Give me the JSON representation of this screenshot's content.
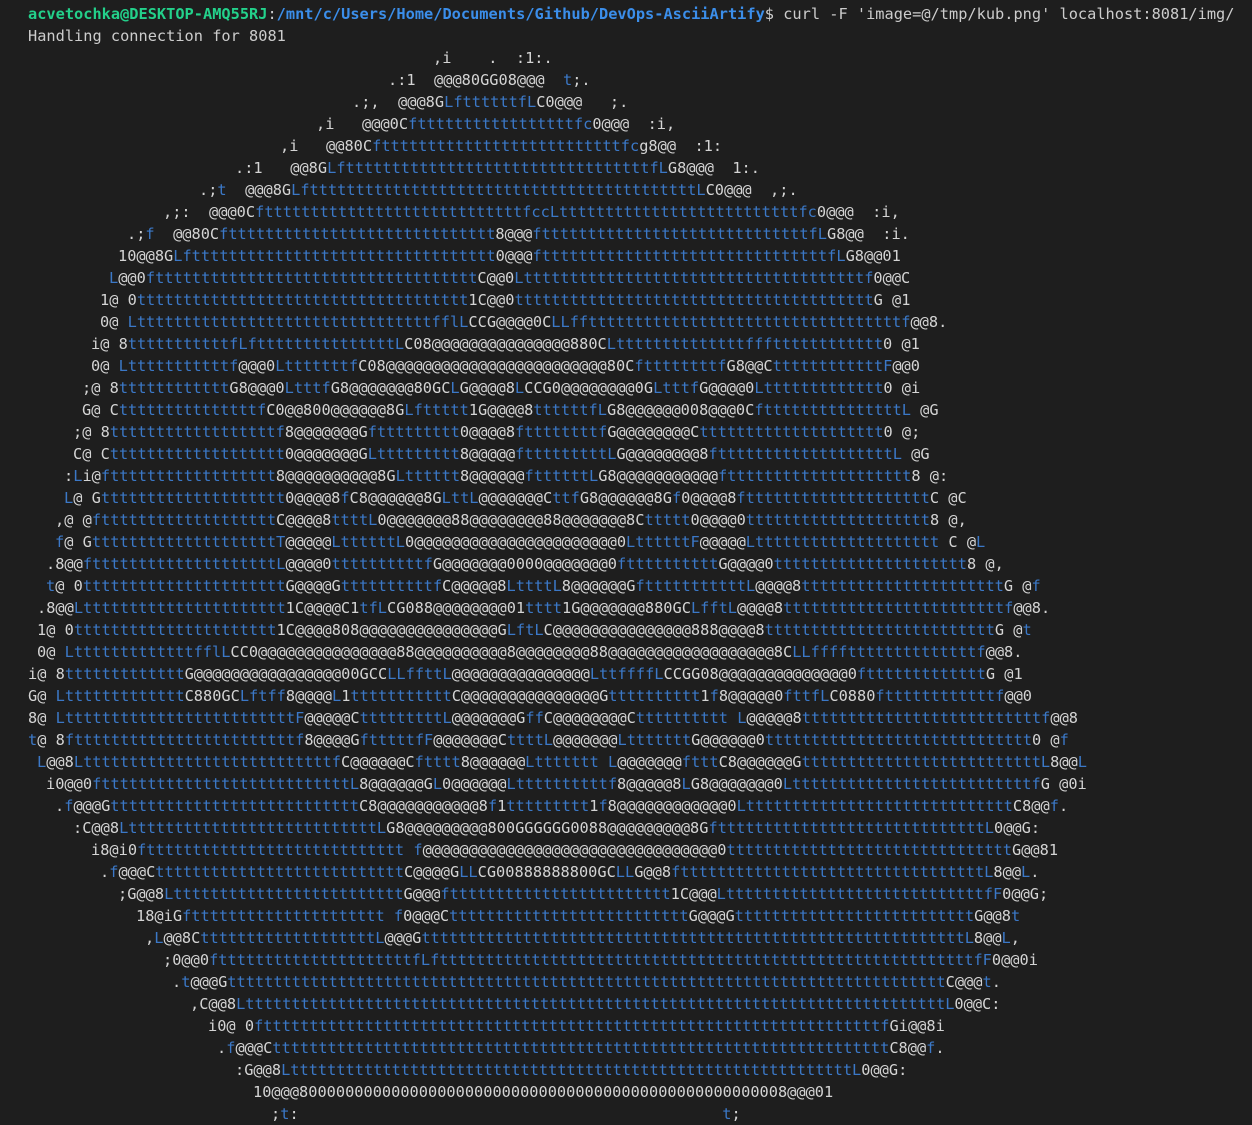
{
  "terminal": {
    "user_host": "acvetochka@DESKTOP-AMQ55RJ",
    "path_sep": ":",
    "cwd": "/mnt/c/Users/Home/Documents/Github/DevOps-AsciiArtify",
    "prompt_symbol": "$",
    "command": " curl -F 'image=@/tmp/kub.png' localhost:8081/img/",
    "status": "Handling connection for 8081",
    "colors": {
      "background": "#1e1e1e",
      "text": "#cccccc",
      "user": "#23d18b",
      "path": "#3b8eea",
      "art_fill": "#3b78c7",
      "art_edge": "#d4d4d4",
      "art_accent": "#d670d6"
    }
  },
  "art": {
    "lines": [
      {
        "indent": 433,
        "text": ",i    .  :1:."
      },
      {
        "indent": 388,
        "text": ".:1  @@@80GG08@@@  t;."
      },
      {
        "indent": 352,
        "text": ".;,  @@@8GLfttttttfLC0@@@   ;."
      },
      {
        "indent": 316,
        "text": ",i   @@@0Cftttttttttttttttttfc0@@@  :i,"
      },
      {
        "indent": 280,
        "text": ",i   @@80Cfttttttttttttttttttttttttttfcg8@@  :1:"
      },
      {
        "indent": 235,
        "text": ".:1   @@8GLftttttttttttttttttttttttttttttttttfLG8@@@  1:."
      },
      {
        "indent": 199,
        "text": ".;t  @@@8GLfttttttttttttttttttttttttttttttttttttttttttLC0@@@  ,;."
      },
      {
        "indent": 163,
        "text": ",;:  @@@0CfttttttttttttttttttttttttttttfccLttttttttttttttttttttttttttfc0@@@  :i,"
      },
      {
        "indent": 127,
        "text": ".;f  @@80Cfttttttttttttttttttttttttttttt8@@@ftttttttttttttttttttttttttttttfLG8@@  :i."
      },
      {
        "indent": 118,
        "text": "10@@8GLfttttttttttttttttttttttttttttttttt0@@@ftttttttttttttttttttttttttttttttfLG8@@01"
      },
      {
        "indent": 109,
        "text": "L@@0ftttttttttttttttttttttttttttttttttttC@@0Ltttttttttttttttttttttttttttttttttttttf0@@C"
      },
      {
        "indent": 100,
        "text": "1@ 0tttttttttttttttttttttttttttttttttttt1C@@0tttttttttttttttttttttttttttttttttttttttG @1"
      },
      {
        "indent": 100,
        "text": "0@ LttttttttttttttttttttttttttttttttfflLCCG@@@@0CLLffttttttttttttttttttttttttttttttttttf@@8."
      },
      {
        "indent": 91,
        "text": "i@ 8tttttttttttfLftttttttttttttttLC08@@@@@@@@@@@@@@@880CLttttttttttttttffftttttttttttt0 @1"
      },
      {
        "indent": 91,
        "text": "0@ Ltttttttttttf@@@0LtttttttfC08@@@@@@@@@@@@@@@@@@@@@@@@80CfttttttttfG8@@CttttttttttttF@@0"
      },
      {
        "indent": 82,
        "text": ";@ 8ttttttttttttG8@@@0LtttfG8@@@@@@@80GCLG@@@@8LCCG0@@@@@@@@0GLtttfG@@@@0Lttttttttttttt0 @i"
      },
      {
        "indent": 82,
        "text": "G@ CtttttttttttttttfC0@@800@@@@@@8GLfttttt1G@@@@8ttttttfLG8@@@@@@008@@@0CftttttttttttttttL @G"
      },
      {
        "indent": 73,
        "text": ";@ 8ttttttttttttttttttf8@@@@@@@Gfttttttttt0@@@@8fttttttttfG@@@@@@@@Ctttttttttttttttttttt0 @;"
      },
      {
        "indent": 73,
        "text": "C@ Cttttttttttttttttttt0@@@@@@@GLttttttttt8@@@@@ftttttttttLG@@@@@@@@8ftttttttttttttttttttL @G"
      },
      {
        "indent": 64,
        "text": ":Li@ftttttttttttttttttt8@@@@@@@@@@8GLtttttt8@@@@@@fttttttLG8@@@@@@@@@@@ftttttttttttttttttttt8 @:"
      },
      {
        "indent": 64,
        "text": "L@ Gtttttttttttttttttttt0@@@@8fC8@@@@@@8GLttL@@@@@@@CttfG8@@@@@@8Gf0@@@@8fttttttttttttttttttttC @C"
      },
      {
        "indent": 55,
        "text": ",@ @ftttttttttttttttttttC@@@@8ttttL0@@@@@@@88@@@@@@@@88@@@@@@@8Cttttt0@@@@0tttttttttttttttttttt8 @,"
      },
      {
        "indent": 55,
        "text": "f@ GttttttttttttttttttttT@@@@@LttttttL0@@@@@@@@@@@@@@@@@@@@@@0LttttttF@@@@@Ltttttttttttttttttttt C @L"
      },
      {
        "indent": 46,
        "text": ".8@@fttttttttttttttttttttL@@@@0ttttttttttfG@@@@@@@0000@@@@@@@0fttttttttttG@@@@0ttttttttttttttttttttt8 @,"
      },
      {
        "indent": 46,
        "text": "t@ 0ttttttttttttttttttttttG@@@@GttttttttttfC@@@@@8LttttL8@@@@@@GftttttttttttL@@@@8ttttttttttttttttttttttG @f"
      },
      {
        "indent": 37,
        "text": ".8@@Ltttttttttttttttttttttt1C@@@@C1tfLCG088@@@@@@@@01tttt1G@@@@@@@880GCLfftL@@@@8ttttttttttttttttttttttttf@@8."
      },
      {
        "indent": 37,
        "text": "1@ 0tttttttttttttttttttttt1C@@@@808@@@@@@@@@@@@@@@GLftLC@@@@@@@@@@@@@@@888@@@@8tttttttttttttttttttttttttG @t"
      },
      {
        "indent": 37,
        "text": "0@ LtttttttttttttfflLCC0@@@@@@@@@@@@@@@88@@@@@@@@@@8@@@@@@@@88@@@@@@@@@@@@@@@@@@8CLLffffttttttttttttttf@@8."
      },
      {
        "indent": 28,
        "text": "i@ 8tttttttttttttG@@@@@@@@@@@@@@@@00GCCLLffttL@@@@@@@@@@@@@@@LttffffLCCGG08@@@@@@@@@@@@@@0ftttttttttttttG @1"
      },
      {
        "indent": 28,
        "text": "G@ LtttttttttttttC880GCLftff8@@@@L1tttttttttttC@@@@@@@@@@@@@@@Gtttttttttt1f8@@@@@0fttfLC0880fttttttttttttf@@0"
      },
      {
        "indent": 28,
        "text": "8@ LtttttttttttttttttttttttttF@@@@@CtttttttttL@@@@@@@GffC@@@@@@@@Ctttttttttt L@@@@@8ttttttttttttttttttttttttttf@@8"
      },
      {
        "indent": 28,
        "text": "t@ 8fttttttttttttttttttttttttf8@@@@GftttttfF@@@@@@@CttttL@@@@@@@LtttttttG@@@@@@0ttttttttttttttttttttttttttttt0 @f"
      },
      {
        "indent": 37,
        "text": "L@@8LtttttttttttttttttttttttttttfC@@@@@@Cftttt8@@@@@@Lttttttt L@@@@@@@ftttC8@@@@@@GttttttttttttttttttttttttttL8@@L"
      },
      {
        "indent": 46,
        "text": "i0@@0ftttttttttttttttttttttttttttL8@@@@@@GL0@@@@@@Lttttttttttf8@@@@@8LG8@@@@@@@0LttttttttttttttttttttttttttfG @0i"
      },
      {
        "indent": 55,
        "text": ".f@@@GtttttttttttttttttttttttttttC8@@@@@@@@@@@8f1ttttttttt1f8@@@@@@@@@@@@0LtttttttttttttttttttttttttttttC8@@f."
      },
      {
        "indent": 73,
        "text": ":C@@8LtttttttttttttttttttttttttttLG8@@@@@@@@@800GGGGGG0088@@@@@@@@@8GftttttttttttttttttttttttttttttL0@@G:"
      },
      {
        "indent": 91,
        "text": "i8@i0ftttttttttttttttttttttttttttt f@@@@@@@@@@@@@@@@@@@@@@@@@@@@@@@@0tttttttttttttttttttttttttttttttG@@81"
      },
      {
        "indent": 100,
        "text": ".f@@@CtttttttttttttttttttttttttttC@@@@GLLCG00888888800GCLLG@@8ftttttttttttttttttttttttttttttttttL8@@L."
      },
      {
        "indent": 118,
        "text": ";G@@8LtttttttttttttttttttttttttG@@@ftttttttttttttttttttttttt1C@@@LttttttttttttttttttttttttttttfF0@@G;"
      },
      {
        "indent": 136,
        "text": "18@iGfttttttttttttttttttttt f0@@@CttttttttttttttttttttttttttG@@@GttttttttttttttttttttttttttG@@8t"
      },
      {
        "indent": 145,
        "text": ",L@@8CtttttttttttttttttttL@@@GtttttttttttttttttttttttttttttttttttttttttttttttttttttttttttL8@@L,"
      },
      {
        "indent": 163,
        "text": ";0@@0ftttttttttttttttttttttfLfttttttttttttttttttttttttttttttttttttttttttttttttttttttttttfF0@@0i"
      },
      {
        "indent": 172,
        "text": ".t@@@GttttttttttttttttttttttttttttttttttttttttttttttttttttttttttttttttttttttttttttttC@@@t."
      },
      {
        "indent": 190,
        "text": ",C@@8LttttttttttttttttttttttttttttttttttttttttttttttttttttttttttttttttttttttttttttL0@@C:"
      },
      {
        "indent": 208,
        "text": "i0@ 0ftttttttttttttttttttttttttttttttttttttttttttttttttttttttttttttttttttfGi@@8i"
      },
      {
        "indent": 217,
        "text": ".f@@@CtttttttttttttttttttttttttttttttttttttttttttttttttttttttttttttttttttC8@@f."
      },
      {
        "indent": 235,
        "text": ":G@@8LtttttttttttttttttttttttttttttttttttttttttttttttttttttttttttttL0@@G:"
      },
      {
        "indent": 253,
        "text": "10@@@80000000000000000000000000000000000000000000000000008@@@01"
      },
      {
        "indent": 271,
        "text": ";t:                                              t;"
      }
    ]
  }
}
